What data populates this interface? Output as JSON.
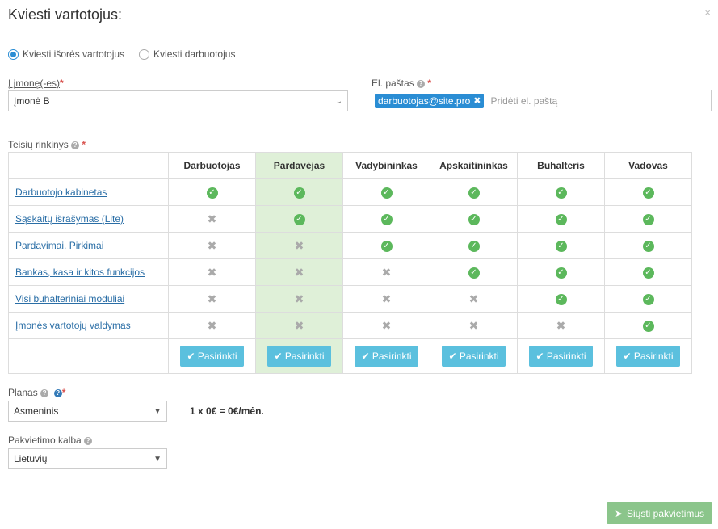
{
  "modal": {
    "title": "Kviesti vartotojus:",
    "close_icon": "×"
  },
  "invite_type": {
    "options": [
      {
        "label": "Kviesti išorės vartotojus",
        "checked": true
      },
      {
        "label": "Kviesti darbuotojus",
        "checked": false
      }
    ]
  },
  "company": {
    "label": "Į įmonę(-es)",
    "required": "*",
    "value": "Įmonė B"
  },
  "email": {
    "label": "El. paštas",
    "required": "*",
    "tag": "darbuotojas@site.pro",
    "placeholder": "Pridėti el. paštą"
  },
  "permissions": {
    "label": "Teisių rinkinys",
    "required": "*",
    "columns": [
      "Darbuotojas",
      "Pardavėjas",
      "Vadybininkas",
      "Apskaitininkas",
      "Buhalteris",
      "Vadovas"
    ],
    "highlighted_column": 1,
    "rows": [
      {
        "label": "Darbuotojo kabinetas",
        "values": [
          true,
          true,
          true,
          true,
          true,
          true
        ]
      },
      {
        "label": "Sąskaitų išrašymas (Lite)",
        "values": [
          false,
          true,
          true,
          true,
          true,
          true
        ]
      },
      {
        "label": "Pardavimai. Pirkimai",
        "values": [
          false,
          false,
          true,
          true,
          true,
          true
        ]
      },
      {
        "label": "Bankas, kasa ir kitos funkcijos",
        "values": [
          false,
          false,
          false,
          true,
          true,
          true
        ]
      },
      {
        "label": "Visi buhalteriniai moduliai",
        "values": [
          false,
          false,
          false,
          false,
          true,
          true
        ]
      },
      {
        "label": "Įmonės vartotojų valdymas",
        "values": [
          false,
          false,
          false,
          false,
          false,
          true
        ]
      }
    ],
    "select_label": "Pasirinkti"
  },
  "plan": {
    "label": "Planas",
    "required": "*",
    "value": "Asmeninis",
    "formula": "1 x 0€ = 0€/mėn."
  },
  "language": {
    "label": "Pakvietimo kalba",
    "value": "Lietuvių"
  },
  "send_button": {
    "label": "Siųsti pakvietimus"
  },
  "colors": {
    "accent": "#2a8dd4",
    "select_button": "#5bc0de",
    "highlight": "#dff0d8",
    "check": "#5cb85c",
    "send": "#8bc58b"
  }
}
